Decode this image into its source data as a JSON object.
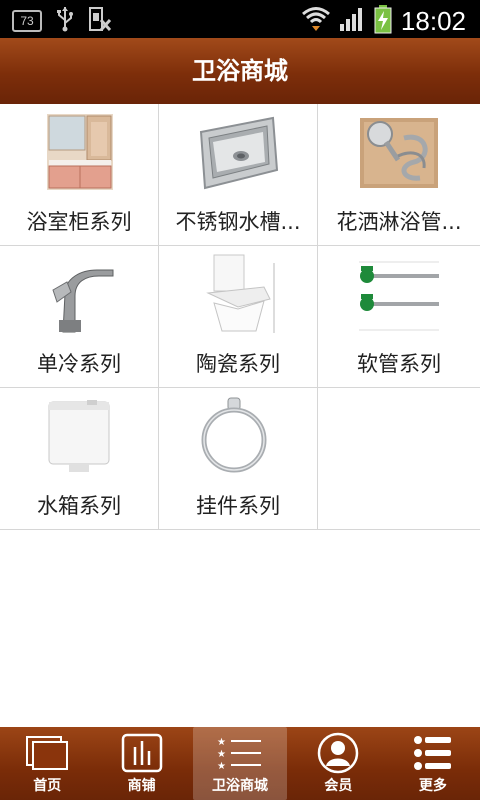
{
  "status_bar": {
    "notification_count": "73",
    "time": "18:02",
    "icons": [
      "usb-icon",
      "sim-icon",
      "wifi-icon",
      "signal-icon",
      "battery-charging-icon"
    ]
  },
  "header": {
    "title": "卫浴商城"
  },
  "categories": [
    {
      "label": "浴室柜系列",
      "icon": "bathroom-cabinet"
    },
    {
      "label": "不锈钢水槽...",
      "icon": "stainless-sink"
    },
    {
      "label": "花洒淋浴管...",
      "icon": "shower-hose"
    },
    {
      "label": "单冷系列",
      "icon": "faucet"
    },
    {
      "label": "陶瓷系列",
      "icon": "toilet"
    },
    {
      "label": "软管系列",
      "icon": "hose"
    },
    {
      "label": "水箱系列",
      "icon": "water-tank"
    },
    {
      "label": "挂件系列",
      "icon": "towel-ring"
    }
  ],
  "bottom_nav": {
    "items": [
      {
        "label": "首页",
        "icon": "home-icon"
      },
      {
        "label": "商铺",
        "icon": "store-icon"
      },
      {
        "label": "卫浴商城",
        "icon": "list-icon",
        "active": true
      },
      {
        "label": "会员",
        "icon": "member-icon"
      },
      {
        "label": "更多",
        "icon": "more-icon"
      }
    ]
  },
  "colors": {
    "header_top": "#a24a1a",
    "header_bottom": "#6a2408",
    "divider": "#d6d6d6"
  }
}
